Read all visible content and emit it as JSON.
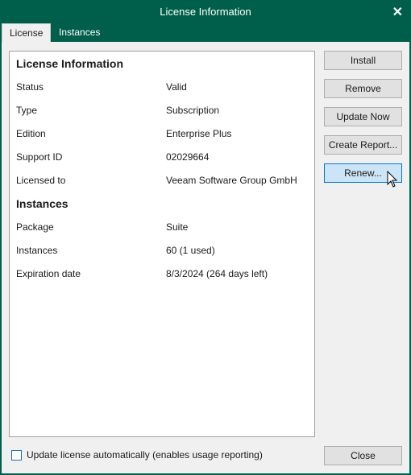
{
  "window": {
    "title": "License Information",
    "close_icon": "close-icon"
  },
  "tabs": [
    {
      "label": "License",
      "active": true
    },
    {
      "label": "Instances",
      "active": false
    }
  ],
  "license_section": {
    "heading": "License Information",
    "rows": [
      {
        "label": "Status",
        "value": "Valid"
      },
      {
        "label": "Type",
        "value": "Subscription"
      },
      {
        "label": "Edition",
        "value": "Enterprise Plus"
      },
      {
        "label": "Support ID",
        "value": "02029664"
      },
      {
        "label": "Licensed to",
        "value": "Veeam Software Group GmbH"
      }
    ]
  },
  "instances_section": {
    "heading": "Instances",
    "rows": [
      {
        "label": "Package",
        "value": "Suite"
      },
      {
        "label": "Instances",
        "value": "60 (1 used)"
      },
      {
        "label": "Expiration date",
        "value": "8/3/2024 (264 days left)"
      }
    ]
  },
  "buttons": {
    "install": "Install",
    "remove": "Remove",
    "update_now": "Update Now",
    "create_report": "Create Report...",
    "renew": "Renew...",
    "close": "Close"
  },
  "auto_update": {
    "label": "Update license automatically (enables usage reporting)",
    "checked": false
  },
  "colors": {
    "title_bar": "#005f4b",
    "hover_button": "#cce4f7",
    "hover_border": "#0078d7"
  }
}
